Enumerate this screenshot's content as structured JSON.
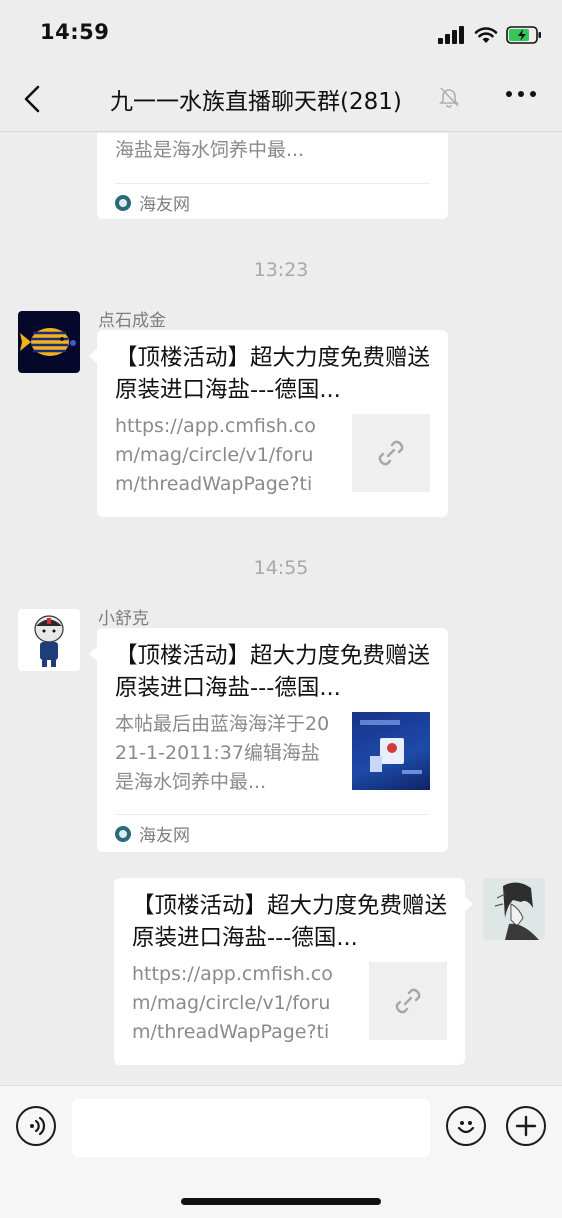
{
  "status": {
    "time": "14:59"
  },
  "nav": {
    "title": "九一一水族直播聊天群",
    "count": "(281)"
  },
  "messages": {
    "top_card": {
      "desc_tail": "海盐是海水饲养中最...",
      "source": "海友网"
    },
    "time1": "13:23",
    "msg1": {
      "sender": "点石成金",
      "title": "【顶楼活动】超大力度免费赠送原装进口海盐---德国...",
      "desc": "https://app.cmfish.com/mag/circle/v1/forum/threadWapPage?tid..."
    },
    "time2": "14:55",
    "msg2": {
      "sender": "小舒克",
      "title": "【顶楼活动】超大力度免费赠送原装进口海盐---德国...",
      "desc": "本帖最后由蓝海海洋于2021-1-2011:37编辑海盐是海水饲养中最...",
      "source": "海友网"
    },
    "msg3": {
      "title": "【顶楼活动】超大力度免费赠送原装进口海盐---德国...",
      "desc": "https://app.cmfish.com/mag/circle/v1/forum/threadWapPage?tid..."
    }
  },
  "input": {
    "placeholder": ""
  },
  "icons": {
    "back": "chevron-left-icon",
    "mute": "bell-slash-icon",
    "more": "more-dots-icon",
    "voice": "voice-icon",
    "emoji": "emoji-icon",
    "plus": "plus-icon",
    "link": "link-icon"
  },
  "colors": {
    "background": "#ededed",
    "bubble": "#ffffff",
    "muted_text": "#8a8a8a",
    "battery": "#34c759"
  }
}
